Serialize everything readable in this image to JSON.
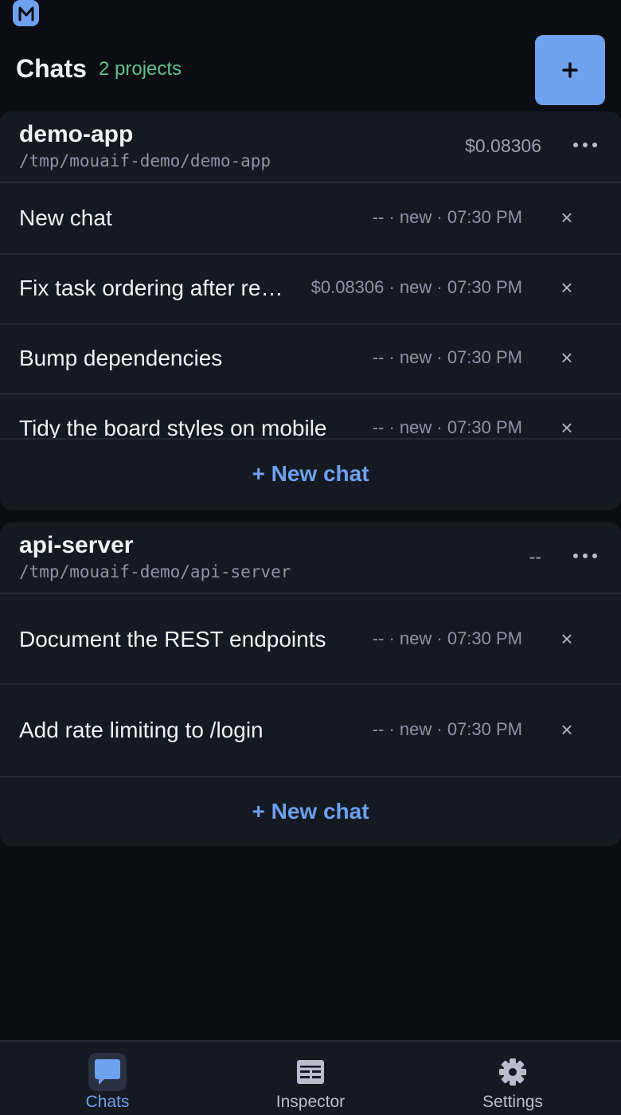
{
  "header": {
    "title": "Chats",
    "project_count": "2 projects",
    "add_button_label": "+"
  },
  "projects": [
    {
      "name": "demo-app",
      "path": "/tmp/mouaif-demo/demo-app",
      "cost": "$0.08306",
      "new_chat_label": "+ New chat",
      "chats": [
        {
          "title": "New chat",
          "meta": "-- · new · 07:30 PM"
        },
        {
          "title": "Fix task ordering after re…",
          "meta": "$0.08306 · new · 07:30 PM"
        },
        {
          "title": "Bump dependencies",
          "meta": "-- · new · 07:30 PM"
        },
        {
          "title": "Tidy the board styles on mobile",
          "meta": "-- · new · 07:30 PM"
        }
      ]
    },
    {
      "name": "api-server",
      "path": "/tmp/mouaif-demo/api-server",
      "cost": "--",
      "new_chat_label": "+ New chat",
      "chats": [
        {
          "title": "Document the REST endpoints",
          "meta": "-- · new · 07:30 PM"
        },
        {
          "title": "Add rate limiting to /login",
          "meta": "-- · new · 07:30 PM"
        }
      ]
    }
  ],
  "close_glyph": "×",
  "tabs": [
    {
      "label": "Chats",
      "icon": "chat-bubble-icon",
      "active": true
    },
    {
      "label": "Inspector",
      "icon": "inspector-icon",
      "active": false
    },
    {
      "label": "Settings",
      "icon": "gear-icon",
      "active": false
    }
  ],
  "colors": {
    "accent": "#6ea1ee",
    "count_green": "#5fc28e",
    "background": "#0b0d12",
    "card": "#151922"
  }
}
